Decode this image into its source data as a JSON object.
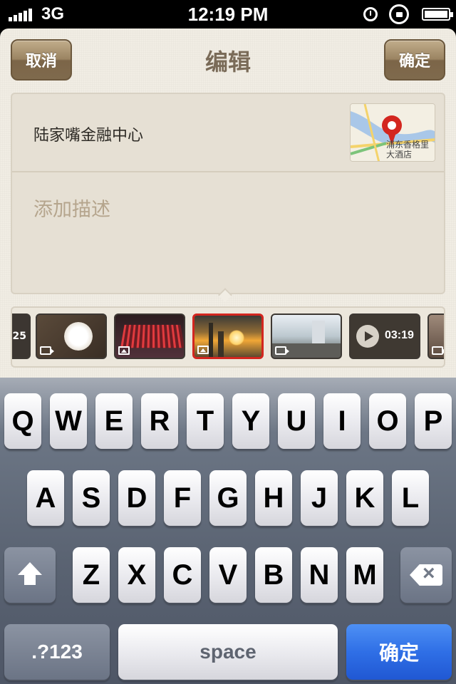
{
  "status_bar": {
    "carrier": "3G",
    "time": "12:19 PM"
  },
  "nav": {
    "cancel_label": "取消",
    "title": "编辑",
    "confirm_label": "确定"
  },
  "location": {
    "name": "陆家嘴金融中心",
    "map_label": "浦东香格里\n大酒店"
  },
  "description": {
    "placeholder": "添加描述"
  },
  "media": {
    "items": [
      {
        "kind": "video",
        "caption": "25"
      },
      {
        "kind": "video",
        "subject": "white blossom"
      },
      {
        "kind": "image",
        "subject": "red pavilion"
      },
      {
        "kind": "image",
        "subject": "sunset skyline",
        "selected": true
      },
      {
        "kind": "video",
        "subject": "city plaza"
      },
      {
        "kind": "video",
        "duration": "03:19"
      },
      {
        "kind": "video",
        "subject": "portrait"
      }
    ]
  },
  "keyboard": {
    "row1": [
      "Q",
      "W",
      "E",
      "R",
      "T",
      "Y",
      "U",
      "I",
      "O",
      "P"
    ],
    "row2": [
      "A",
      "S",
      "D",
      "F",
      "G",
      "H",
      "J",
      "K",
      "L"
    ],
    "row3": [
      "Z",
      "X",
      "C",
      "V",
      "B",
      "N",
      "M"
    ],
    "mode_label": ".?123",
    "space_label": "space",
    "return_label": "确定"
  },
  "colors": {
    "accent_red": "#d3261f",
    "keyboard_go": "#2f6fe6",
    "nav_button": "#9b8462"
  }
}
